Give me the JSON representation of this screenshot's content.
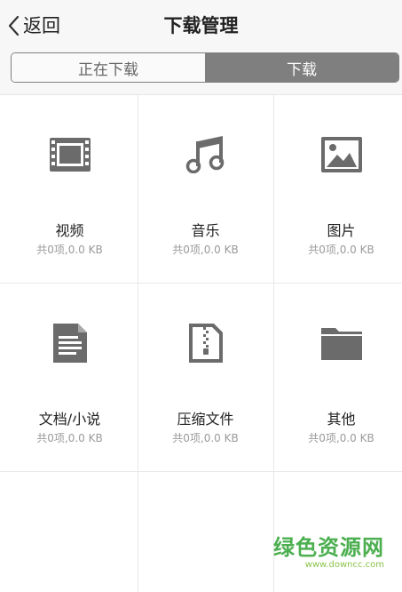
{
  "header": {
    "back_label": "返回",
    "title": "下载管理"
  },
  "tabs": [
    {
      "label": "正在下载",
      "active": false
    },
    {
      "label": "下载",
      "active": true
    }
  ],
  "categories": [
    {
      "label": "视频",
      "stat": "共0项,0.0 KB",
      "icon": "film-icon"
    },
    {
      "label": "音乐",
      "stat": "共0项,0.0 KB",
      "icon": "music-note-icon"
    },
    {
      "label": "图片",
      "stat": "共0项,0.0 KB",
      "icon": "image-icon"
    },
    {
      "label": "文档/小说",
      "stat": "共0项,0.0 KB",
      "icon": "document-icon"
    },
    {
      "label": "压缩文件",
      "stat": "共0项,0.0 KB",
      "icon": "zip-file-icon"
    },
    {
      "label": "其他",
      "stat": "共0项,0.0 KB",
      "icon": "folder-icon"
    }
  ],
  "watermark": {
    "text": "绿色资源网",
    "url": "www.downcc.com"
  },
  "colors": {
    "icon": "#6b6b6b",
    "segment_active": "#7f7f7f",
    "watermark": "#4caf50"
  }
}
